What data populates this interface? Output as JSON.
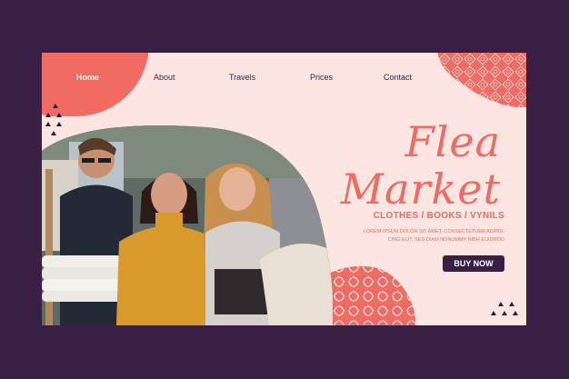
{
  "nav": {
    "items": [
      {
        "label": "Home",
        "active": true
      },
      {
        "label": "About",
        "active": false
      },
      {
        "label": "Travels",
        "active": false
      },
      {
        "label": "Prices",
        "active": false
      },
      {
        "label": "Contact",
        "active": false
      }
    ]
  },
  "hero": {
    "title_line1": "Flea",
    "title_line2": "Market",
    "subtitle": "CLOTHES / BOOKS / VYNILS",
    "body_line1": "LOREM IPSUM DOLOR SIT AMET, CONSECTETUER ADIPIS-",
    "body_line2": "CING ELIT, SED DIAM NONUMMY NIBH EUISMOD",
    "cta_label": "BUY NOW"
  },
  "colors": {
    "background": "#3a1f44",
    "card": "#fde6e1",
    "accent": "#f16b63",
    "dark": "#3a1f44"
  },
  "photo": {
    "description_icon": "people-shopping-photo"
  }
}
